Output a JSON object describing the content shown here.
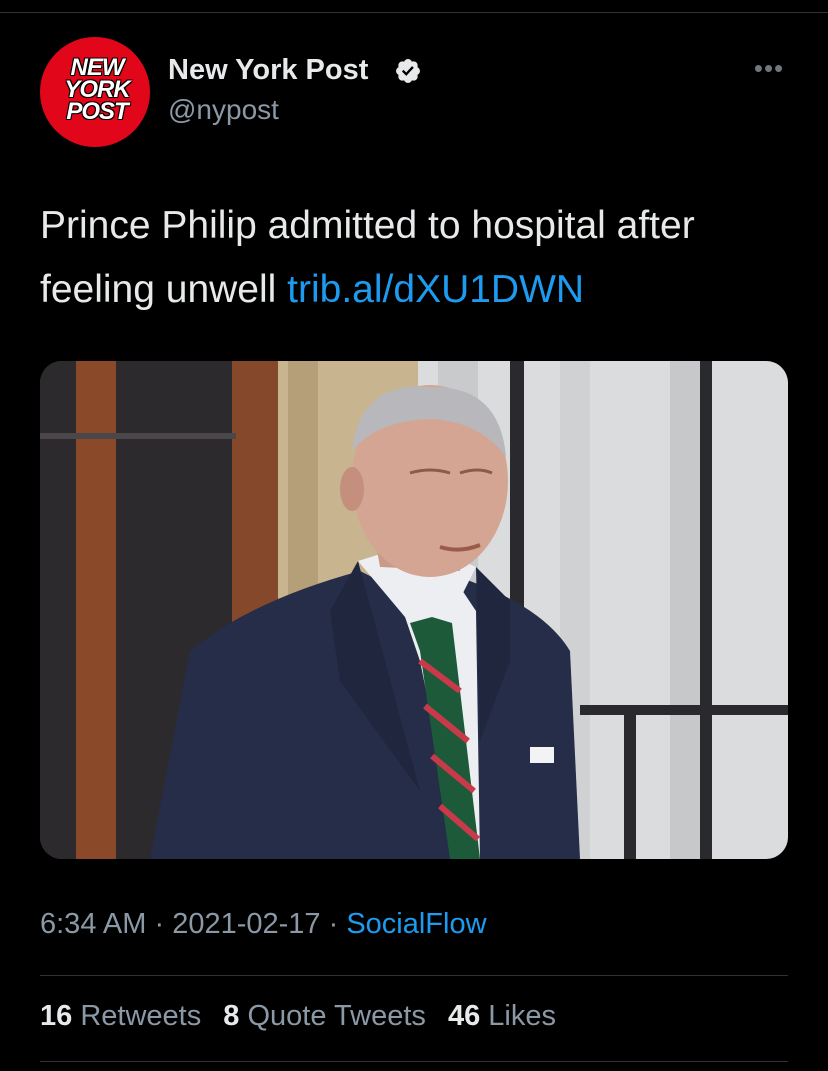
{
  "tweet": {
    "author_name": "New York Post",
    "author_handle": "@nypost",
    "avatar_text": [
      "NEW",
      "YORK",
      "POST"
    ],
    "text": "Prince Philip admitted to hospital after feeling unwell ",
    "link": "trib.al/dXU1DWN",
    "time": "6:34 AM",
    "date": "2021-02-17",
    "separator": " · ",
    "source": "SocialFlow",
    "stats": [
      {
        "count": "16",
        "label": "Retweets"
      },
      {
        "count": "8",
        "label": "Quote Tweets"
      },
      {
        "count": "46",
        "label": "Likes"
      }
    ]
  },
  "icons": {
    "verified": "verified-badge-icon",
    "more": "more-options-icon"
  },
  "colors": {
    "background": "#000000",
    "link": "#1d9bf0",
    "avatar_red": "#e2061b",
    "secondary_text": "#8b98a5"
  }
}
